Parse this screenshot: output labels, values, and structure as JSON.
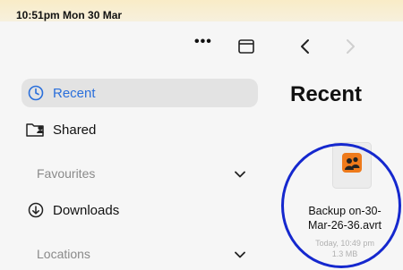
{
  "status_bar": {
    "time": "10:51pm Mon 30 Mar"
  },
  "toolbar": {
    "more": "•••"
  },
  "sidebar": {
    "recent_label": "Recent",
    "shared_label": "Shared",
    "favourites_label": "Favourites",
    "downloads_label": "Downloads",
    "locations_label": "Locations"
  },
  "main": {
    "title": "Recent",
    "file": {
      "name_line1": "Backup on-30-",
      "name_line2": "Mar-26-36.avrt",
      "date": "Today, 10:49 pm",
      "size": "1.3 MB"
    }
  },
  "colors": {
    "accent": "#2a6fdb",
    "file_icon": "#ee7a1b",
    "highlight": "#1528ce"
  }
}
